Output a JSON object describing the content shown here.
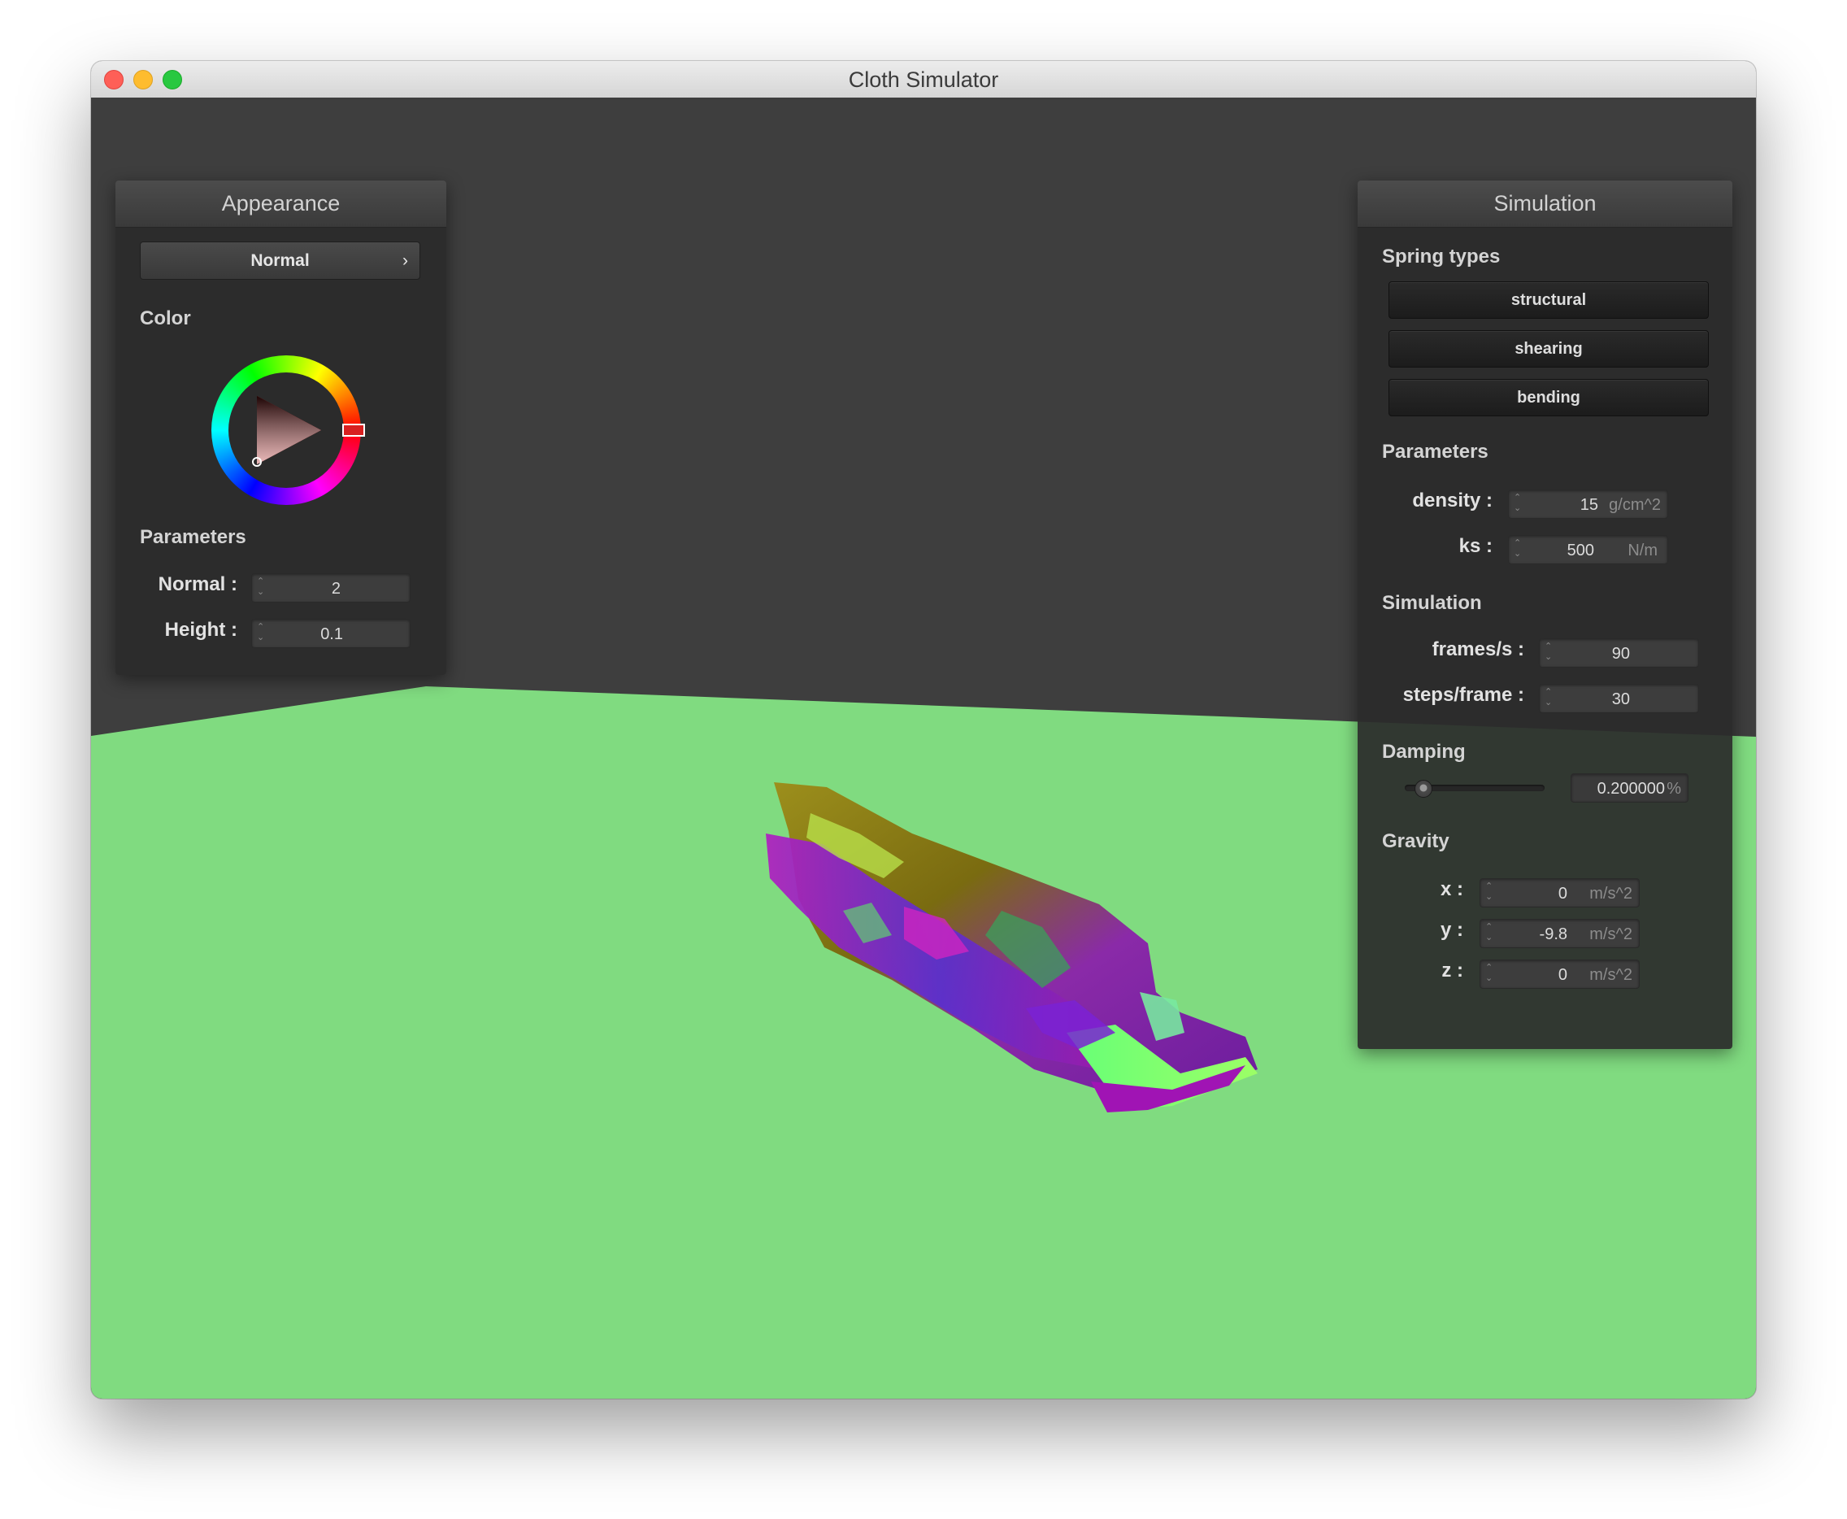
{
  "window": {
    "title": "Cloth Simulator"
  },
  "colors": {
    "floor": "#80db80",
    "background": "#3e3e3e",
    "panel": "#2b2b2b",
    "selected_color": "#ff0000"
  },
  "appearance_panel": {
    "title": "Appearance",
    "shader_dropdown": {
      "value": "Normal",
      "chevron": "›"
    },
    "color_label": "Color",
    "parameters_label": "Parameters",
    "normal": {
      "label": "Normal :",
      "value": "2"
    },
    "height": {
      "label": "Height :",
      "value": "0.1"
    }
  },
  "simulation_panel": {
    "title": "Simulation",
    "spring_types_label": "Spring types",
    "spring_buttons": [
      "structural",
      "shearing",
      "bending"
    ],
    "parameters_label": "Parameters",
    "density": {
      "label": "density :",
      "value": "15",
      "unit": "g/cm^2"
    },
    "ks": {
      "label": "ks :",
      "value": "500",
      "unit": "N/m"
    },
    "simulation_label": "Simulation",
    "frames_per_s": {
      "label": "frames/s :",
      "value": "90"
    },
    "steps_per_frame": {
      "label": "steps/frame :",
      "value": "30"
    },
    "damping_label": "Damping",
    "damping": {
      "value": "0.200000",
      "unit": "%",
      "slider_fraction": 0.2
    },
    "gravity_label": "Gravity",
    "gravity_x": {
      "label": "x :",
      "value": "0",
      "unit": "m/s^2"
    },
    "gravity_y": {
      "label": "y :",
      "value": "-9.8",
      "unit": "m/s^2"
    },
    "gravity_z": {
      "label": "z :",
      "value": "0",
      "unit": "m/s^2"
    }
  }
}
